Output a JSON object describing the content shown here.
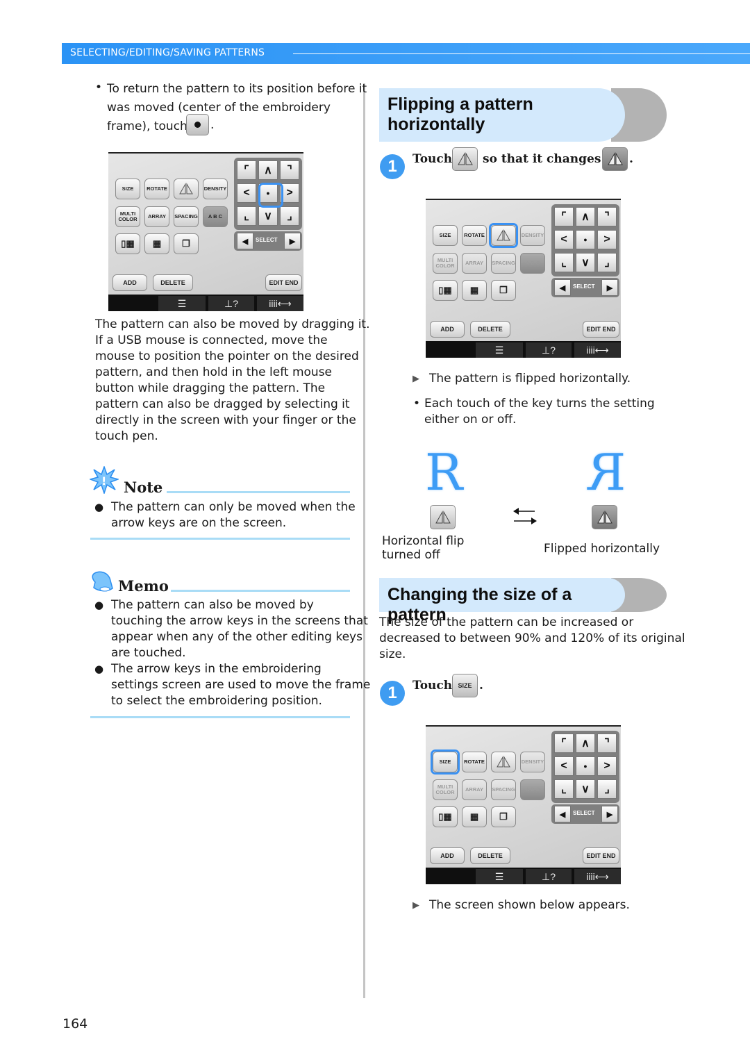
{
  "header": {
    "section": "SELECTING/EDITING/SAVING PATTERNS"
  },
  "left": {
    "intro_lines": [
      "To return the pattern to its position before it",
      "was moved (center of the embroidery",
      "frame), touch"
    ],
    "intro_end": ".",
    "paragraph": [
      "The pattern can also be moved by dragging it.",
      "If a USB mouse is connected, move the",
      "mouse to position the pointer on the desired",
      "pattern, and then hold in the left mouse",
      "button while dragging the pattern. The",
      "pattern can also be dragged by selecting it",
      "directly in the screen with your finger or the",
      "touch pen."
    ],
    "note": {
      "title": "Note",
      "items": [
        [
          "The pattern can only be moved when the",
          "arrow keys are on the screen."
        ]
      ]
    },
    "memo": {
      "title": "Memo",
      "items": [
        [
          "The pattern can also be moved by",
          "touching the arrow keys in the screens that",
          "appear when any of the other editing keys",
          "are touched."
        ],
        [
          "The arrow keys in the embroidering",
          "settings screen are used to move the frame",
          "to select the embroidering position."
        ]
      ]
    }
  },
  "screen": {
    "size": "SIZE",
    "rotate": "ROTATE",
    "density": "DENSITY",
    "multi_color": "MULTI COLOR",
    "array": "ARRAY",
    "spacing": "SPACING",
    "abc": "A B C",
    "select": "SELECT",
    "add": "ADD",
    "delete": "DELETE",
    "edit_end": "EDIT END",
    "help": "?"
  },
  "flip": {
    "title_lines": [
      "Flipping a pattern",
      "horizontally"
    ],
    "step_number": "1",
    "step_touch": "Touch",
    "step_mid": "so that it changes to",
    "step_end": ".",
    "result": "The pattern is flipped horizontally.",
    "bullet_lines": [
      "Each touch of the key turns the setting",
      "either on or off."
    ],
    "pattern_letter": "R",
    "off_label": [
      "Horizontal flip",
      "turned off"
    ],
    "on_label": "Flipped horizontally"
  },
  "size": {
    "title": "Changing the size of a pattern",
    "paragraph": [
      "The size of the pattern can be increased or",
      "decreased to between 90% and 120% of its original",
      "size."
    ],
    "step_number": "1",
    "step_touch": "Touch",
    "step_end": ".",
    "result": "The screen shown below appears."
  },
  "page_number": "164",
  "colors": {
    "accent": "#2b93f5",
    "rule": "#a9dcf6",
    "heading_bg": "#d3e9fc"
  }
}
